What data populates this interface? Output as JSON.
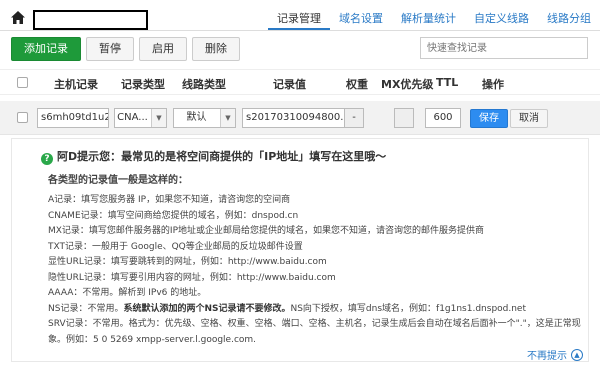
{
  "nav": {
    "tabs": [
      "记录管理",
      "域名设置",
      "解析量统计",
      "自定义线路",
      "线路分组"
    ]
  },
  "toolbar": {
    "add": "添加记录",
    "pause": "暂停",
    "enable": "启用",
    "delete": "删除",
    "search_placeholder": "快速查找记录"
  },
  "table": {
    "headers": {
      "host": "主机记录",
      "type": "记录类型",
      "line": "线路类型",
      "value": "记录值",
      "weight": "权重",
      "mx": "MX优先级",
      "ttl": "TTL",
      "action": "操作"
    },
    "edit_row": {
      "host": "s6mh09td1u2c",
      "type": "CNA...",
      "line": "默认",
      "value": "s20170310094800.r",
      "weight": "-",
      "mx": "",
      "ttl": "600",
      "save": "保存",
      "cancel": "取消"
    }
  },
  "tip": {
    "title": "阿D提示您：最常见的是将空间商提供的「IP地址」填写在这里哦～",
    "subtitle": "各类型的记录值一般是这样的：",
    "line_a": "A记录：填写您服务器 IP，如果您不知道，请咨询您的空间商",
    "line_cname": "CNAME记录：填写空间商给您提供的域名，例如：dnspod.cn",
    "line_mx": "MX记录：填写您邮件服务器的IP地址或企业邮局给您提供的域名，如果您不知道，请咨询您的邮件服务提供商",
    "line_txt": "TXT记录：一般用于 Google、QQ等企业邮局的反垃圾邮件设置",
    "line_url": "显性URL记录：填写要跳转到的网址，例如：http://www.baidu.com",
    "line_hurl": "隐性URL记录：填写要引用内容的网址，例如：http://www.baidu.com",
    "line_aaaa": "AAAA：不常用。解析到 IPv6 的地址。",
    "line_ns_1": "NS记录：不常用。",
    "line_ns_2": "系统默认添加的两个NS记录请不要修改。",
    "line_ns_3": "NS向下授权，填写dns域名，例如：f1g1ns1.dnspod.net",
    "line_srv_1": "SRV记录：不常用。格式为：优先级、空格、权重、空格、端口、空格、主机名，记录生成后会自动在域名后面补一个\".\"，这是正常现",
    "line_srv_2": "象。",
    "line_srv_3": "例如：5 0 5269 xmpp-server.l.google.com.",
    "dismiss": "不再提示"
  }
}
